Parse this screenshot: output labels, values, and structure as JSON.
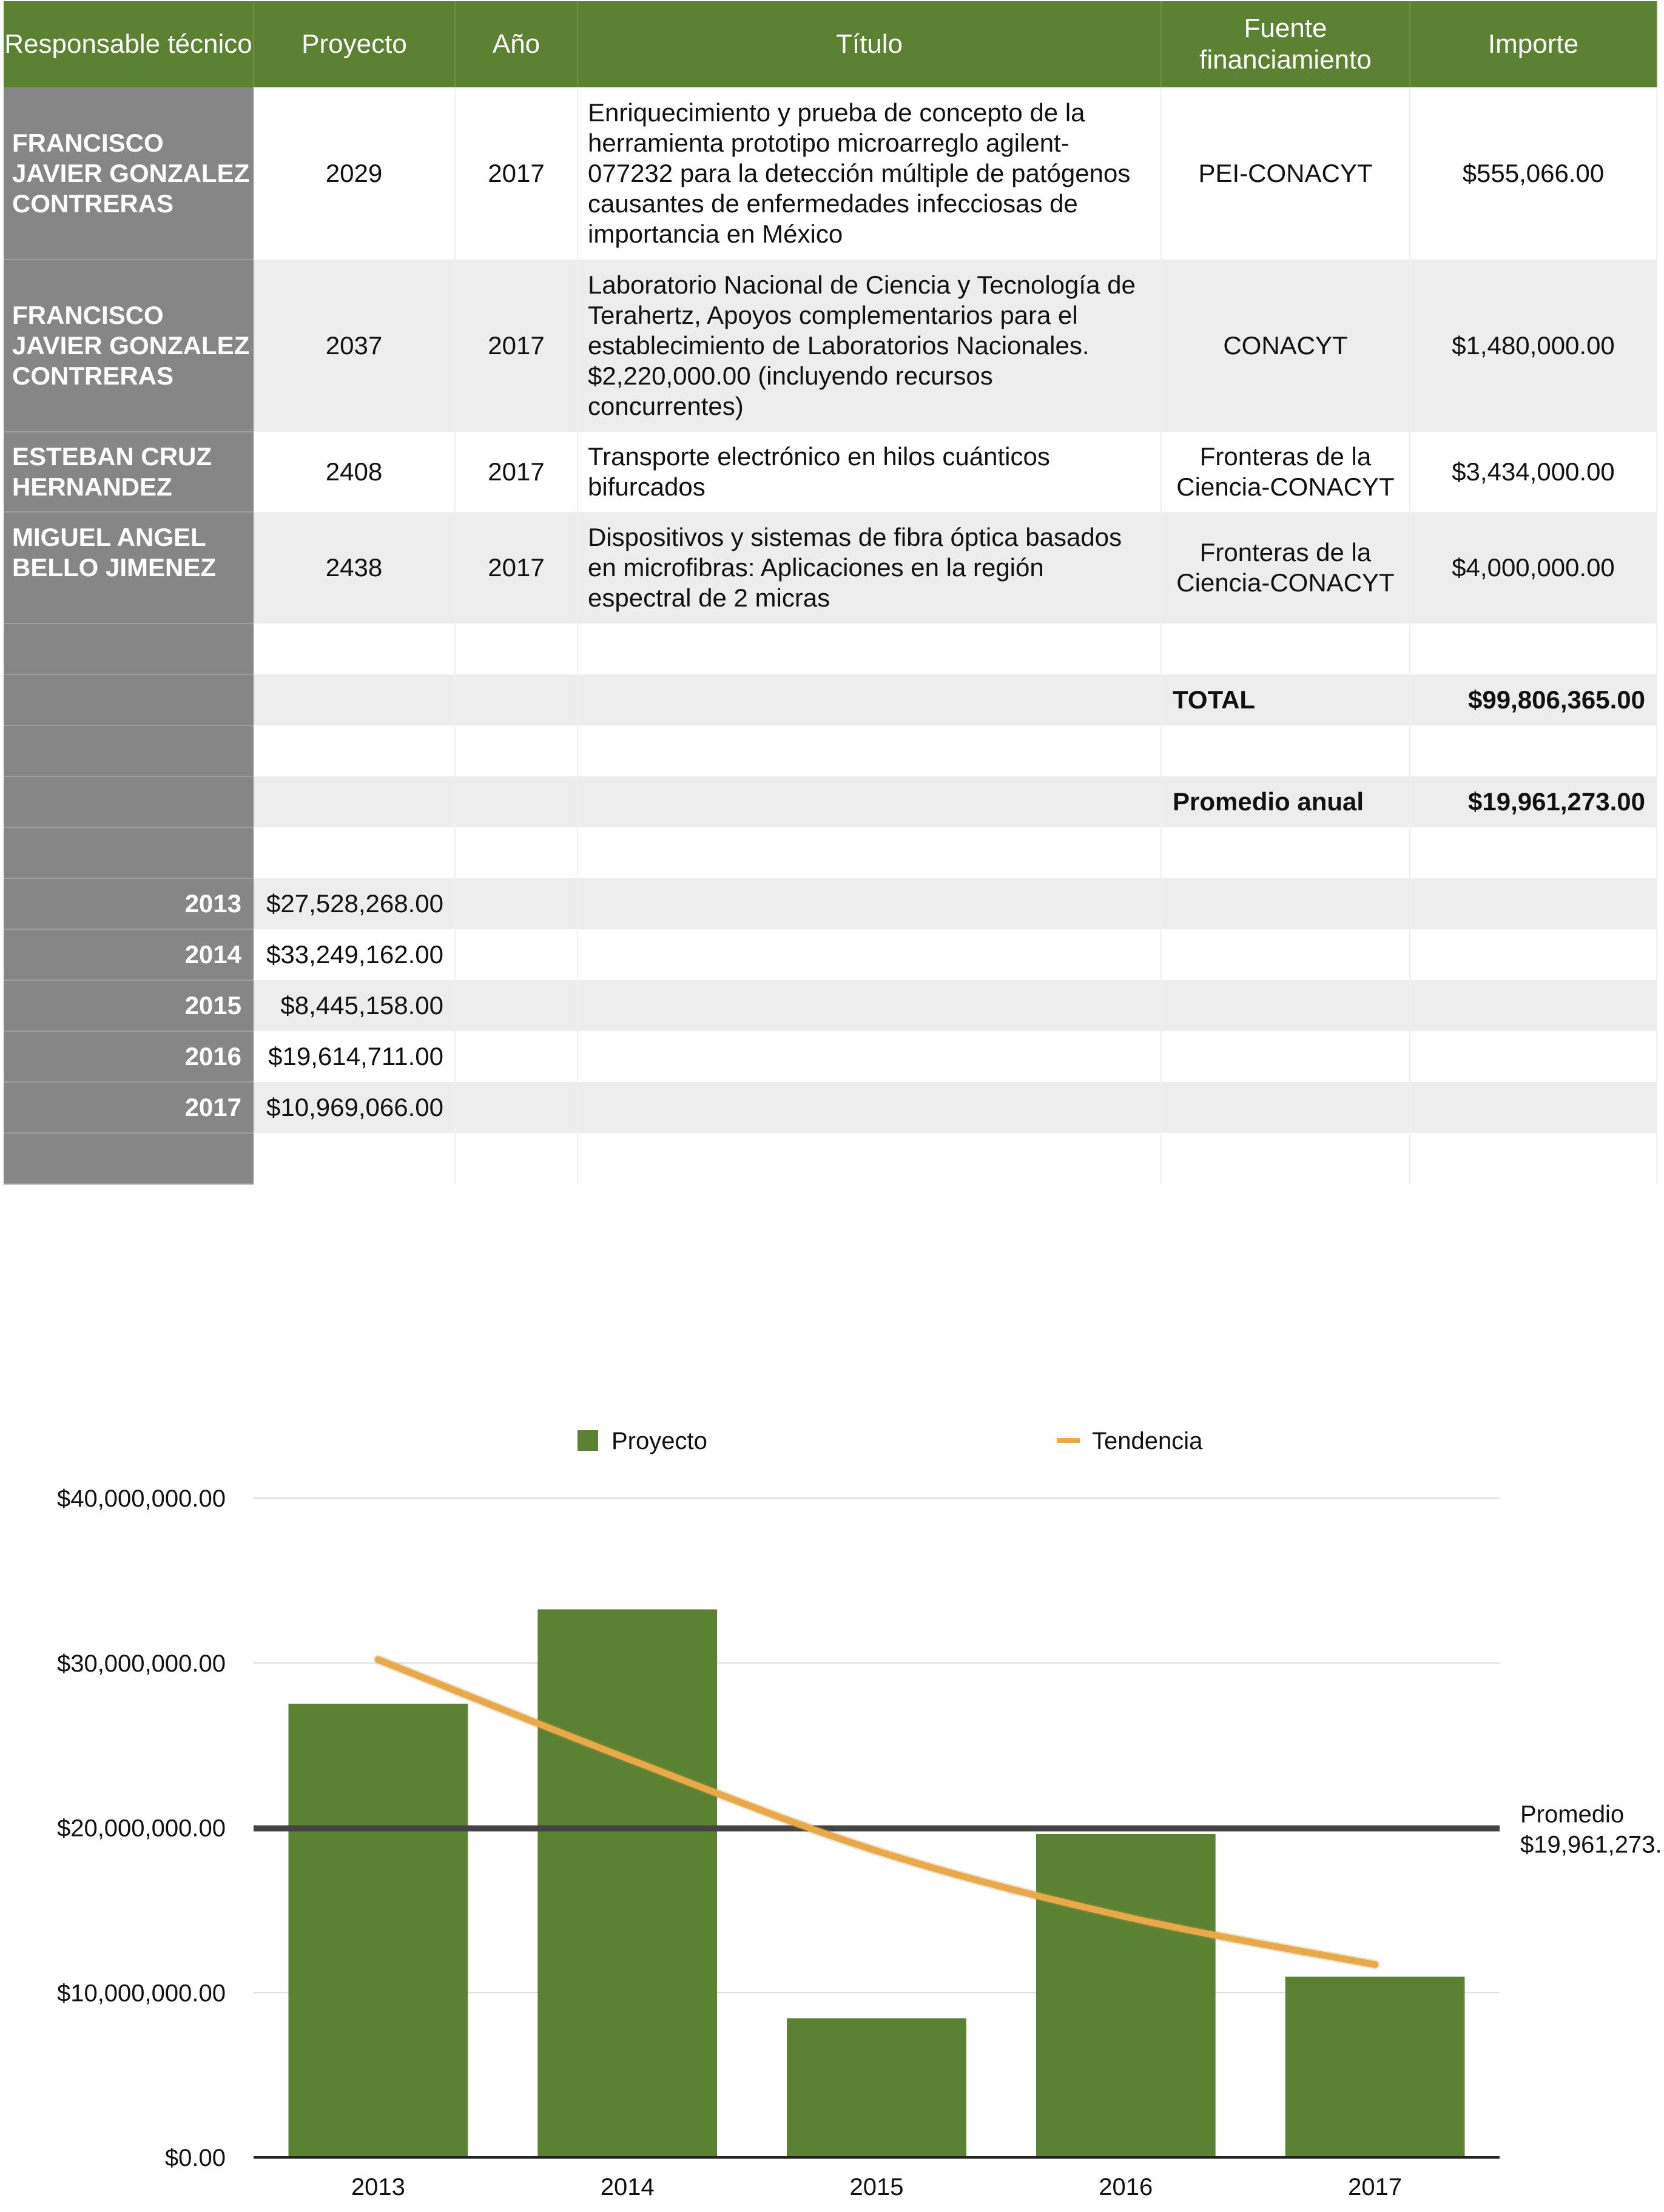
{
  "table": {
    "headers": [
      "Responsable técnico",
      "Proyecto",
      "Año",
      "Título",
      "Fuente financiamiento",
      "Importe"
    ],
    "rows": [
      {
        "responsable": "FRANCISCO JAVIER GONZALEZ CONTRERAS",
        "proyecto": "2029",
        "anio": "2017",
        "titulo": "Enriquecimiento y prueba de concepto de la herramienta prototipo microarreglo agilent-077232 para la detección múltiple de patógenos causantes de enfermedades infecciosas de importancia en México",
        "fuente": "PEI-CONACYT",
        "importe": "$555,066.00"
      },
      {
        "responsable": "FRANCISCO JAVIER GONZALEZ CONTRERAS",
        "proyecto": "2037",
        "anio": "2017",
        "titulo": "Laboratorio Nacional de Ciencia y Tecnología de Terahertz, Apoyos complementarios para el establecimiento de Laboratorios Nacionales. $2,220,000.00 (incluyendo recursos concurrentes)",
        "fuente": "CONACYT",
        "importe": "$1,480,000.00"
      },
      {
        "responsable": "ESTEBAN CRUZ HERNANDEZ",
        "proyecto": "2408",
        "anio": "2017",
        "titulo": "Transporte electrónico en hilos cuánticos bifurcados",
        "fuente": "Fronteras de la Ciencia-CONACYT",
        "importe": "$3,434,000.00"
      },
      {
        "responsable": "MIGUEL ANGEL BELLO JIMENEZ",
        "proyecto": "2438",
        "anio": "2017",
        "titulo": "Dispositivos y sistemas de fibra óptica basados en microfibras: Aplicaciones en la región espectral de 2 micras",
        "fuente": "Fronteras de la Ciencia-CONACYT",
        "importe": "$4,000,000.00"
      }
    ],
    "total_label": "TOTAL",
    "total_value": "$99,806,365.00",
    "promedio_label": "Promedio anual",
    "promedio_value": "$19,961,273.00",
    "yearly": [
      {
        "year": "2013",
        "amount": "$27,528,268.00"
      },
      {
        "year": "2014",
        "amount": "$33,249,162.00"
      },
      {
        "year": "2015",
        "amount": "$8,445,158.00"
      },
      {
        "year": "2016",
        "amount": "$19,614,711.00"
      },
      {
        "year": "2017",
        "amount": "$10,969,066.00"
      }
    ]
  },
  "chart_data": {
    "type": "bar",
    "categories": [
      "2013",
      "2014",
      "2015",
      "2016",
      "2017"
    ],
    "series": [
      {
        "name": "Proyecto",
        "values": [
          27528268,
          33249162,
          8445158,
          19614711,
          10969066
        ]
      }
    ],
    "trend": {
      "name": "Tendencia",
      "values": [
        30200000,
        24200000,
        18600000,
        14600000,
        11700000
      ]
    },
    "average": {
      "label": "Promedio",
      "value": 19961273,
      "value_label": "$19,961,273."
    },
    "ytick_labels": [
      "$0.00",
      "$10,000,000.00",
      "$20,000,000.00",
      "$30,000,000.00",
      "$40,000,000.00"
    ],
    "ylim": [
      0,
      40000000
    ],
    "legend_position": "top",
    "grid": true,
    "colors": {
      "bar": "#5b8232",
      "trend": "#e8a94a",
      "average": "#444444",
      "grid": "#dcdcdc"
    }
  }
}
